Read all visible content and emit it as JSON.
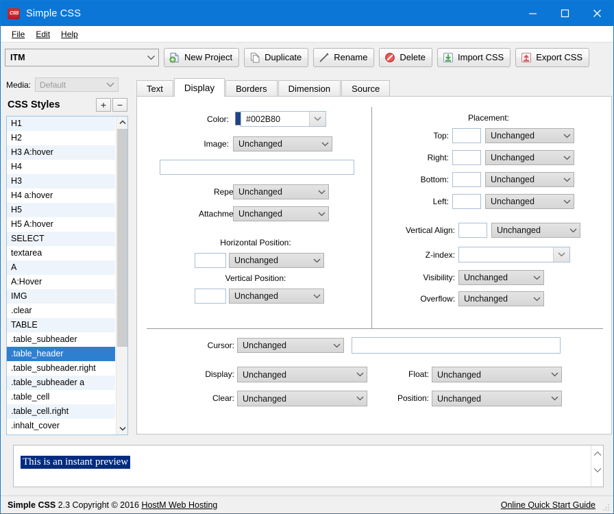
{
  "window": {
    "title": "Simple CSS",
    "icon": "app-icon-css",
    "minimize": "–",
    "maximize": "☐",
    "close": "×"
  },
  "menu": {
    "items": [
      {
        "label": "File"
      },
      {
        "label": "Edit"
      },
      {
        "label": "Help"
      }
    ]
  },
  "toolbar": {
    "project_value": "ITM",
    "buttons": [
      {
        "label": "New Project",
        "icon": "new-project-icon"
      },
      {
        "label": "Duplicate",
        "icon": "duplicate-icon"
      },
      {
        "label": "Rename",
        "icon": "rename-pencil-icon"
      },
      {
        "label": "Delete",
        "icon": "delete-forbidden-icon"
      },
      {
        "label": "Import CSS",
        "icon": "import-download-icon"
      },
      {
        "label": "Export CSS",
        "icon": "export-upload-icon"
      }
    ]
  },
  "sidebar": {
    "media_label": "Media:",
    "media_value": "Default",
    "styles_title": "CSS Styles",
    "add_label": "+",
    "remove_label": "−",
    "items": [
      "H1",
      "H2",
      "H3 A:hover",
      "H4",
      "H3",
      "H4 a:hover",
      "H5",
      "H5 A:hover",
      "SELECT",
      "textarea",
      "A",
      "A:Hover",
      "IMG",
      ".clear",
      "TABLE",
      ".table_subheader",
      ".table_header",
      ".table_subheader.right",
      ".table_subheader a",
      ".table_cell",
      ".table_cell.right",
      ".inhalt_cover"
    ],
    "selected_index": 16
  },
  "tabs": {
    "items": [
      "Text",
      "Display",
      "Borders",
      "Dimension",
      "Source"
    ],
    "active_index": 1
  },
  "display": {
    "color_label": "Color:",
    "color_value": "#002B80",
    "color_swatch": "#1F4389",
    "image_label": "Image:",
    "image_value": "Unchanged",
    "image_url_value": "",
    "repeat_label": "Repeat:",
    "repeat_value": "Unchanged",
    "attachment_label": "Attachment:",
    "attachment_value": "Unchanged",
    "hpos_title": "Horizontal Position:",
    "hpos_num": "",
    "hpos_value": "Unchanged",
    "vpos_title": "Vertical Position:",
    "vpos_num": "",
    "vpos_value": "Unchanged",
    "placement_title": "Placement:",
    "top_label": "Top:",
    "top_num": "",
    "top_value": "Unchanged",
    "right_label": "Right:",
    "right_num": "",
    "right_value": "Unchanged",
    "bottom_label": "Bottom:",
    "bottom_num": "",
    "bottom_value": "Unchanged",
    "left_label": "Left:",
    "left_num": "",
    "left_value": "Unchanged",
    "valign_label": "Vertical Align:",
    "valign_num": "",
    "valign_value": "Unchanged",
    "zindex_label": "Z-index:",
    "zindex_value": "",
    "visibility_label": "Visibility:",
    "visibility_value": "Unchanged",
    "overflow_label": "Overflow:",
    "overflow_value": "Unchanged",
    "cursor_label": "Cursor:",
    "cursor_value": "Unchanged",
    "cursor_url_value": "",
    "display_label": "Display:",
    "display_value": "Unchanged",
    "clear_label": "Clear:",
    "clear_value": "Unchanged",
    "float_label": "Float:",
    "float_value": "Unchanged",
    "position_label": "Position:",
    "position_value": "Unchanged"
  },
  "preview": {
    "text": "This is an instant preview",
    "bg_color": "#002B80",
    "text_color": "#FFFFFF"
  },
  "status": {
    "app_name": "Simple CSS",
    "version_copyright": " 2.3 Copyright © 2016 ",
    "vendor_link": "HostM Web Hosting",
    "help_link": "Online Quick Start Guide"
  }
}
